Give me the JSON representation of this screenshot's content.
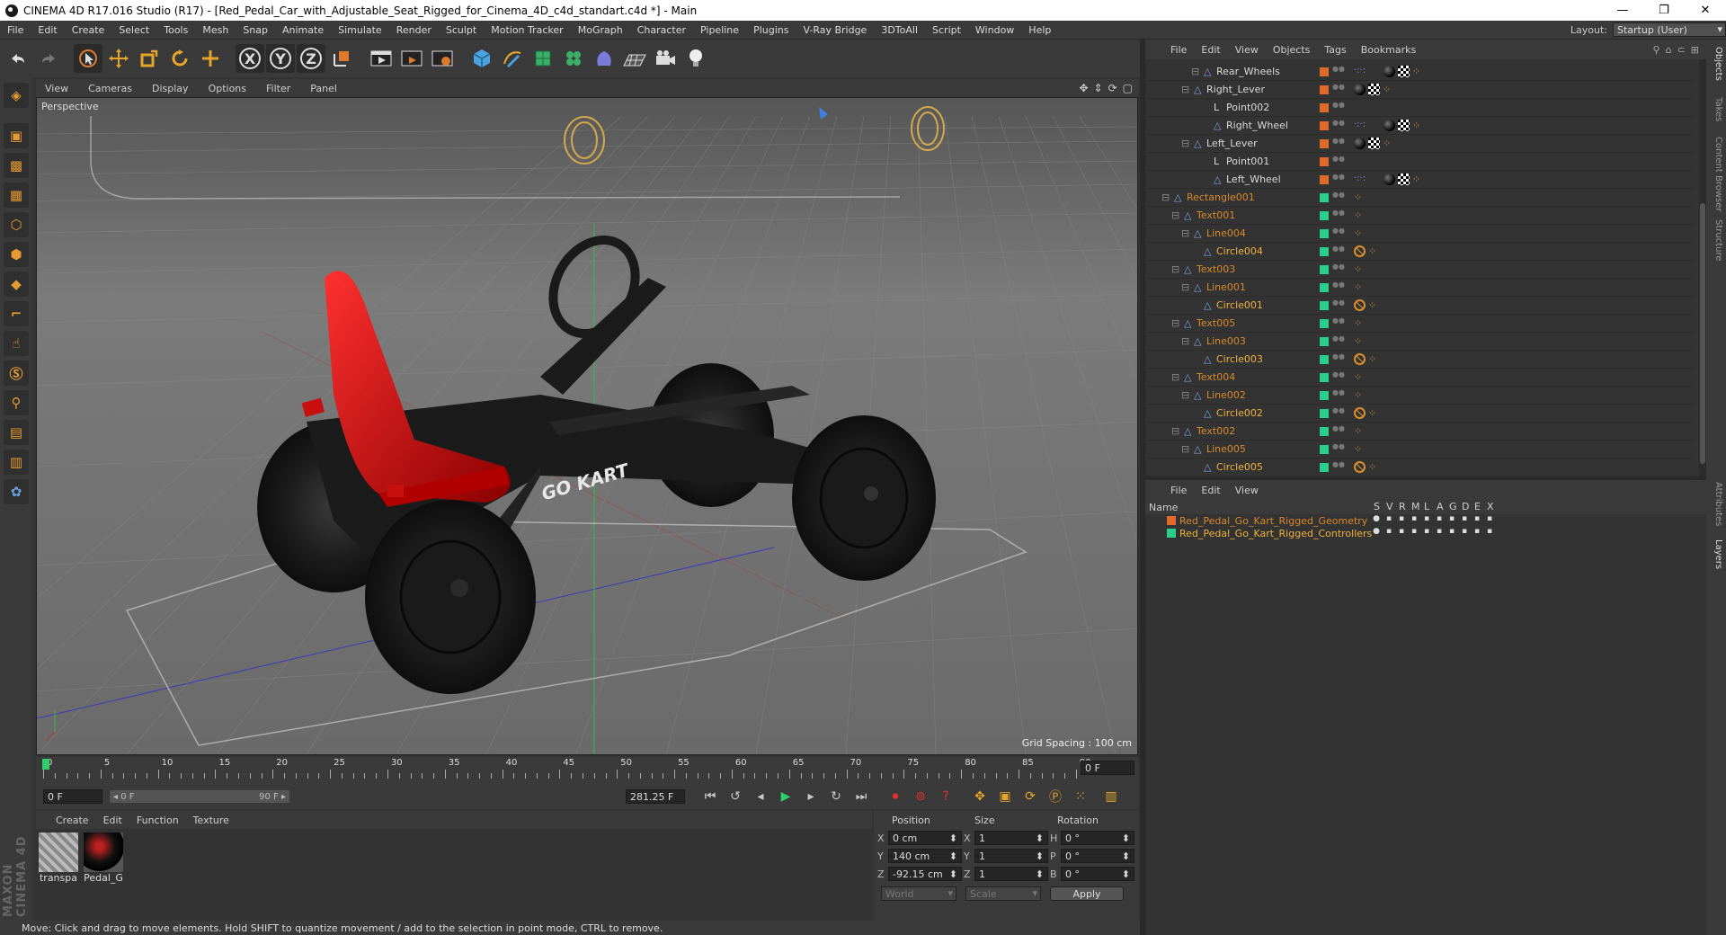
{
  "window": {
    "title": "CINEMA 4D R17.016 Studio (R17) - [Red_Pedal_Car_with_Adjustable_Seat_Rigged_for_Cinema_4D_c4d_standart.c4d *] - Main",
    "controls": [
      "—",
      "❐",
      "✕"
    ]
  },
  "menu": [
    "File",
    "Edit",
    "Create",
    "Select",
    "Tools",
    "Mesh",
    "Snap",
    "Animate",
    "Simulate",
    "Render",
    "Sculpt",
    "Motion Tracker",
    "MoGraph",
    "Character",
    "Pipeline",
    "Plugins",
    "V-Ray Bridge",
    "3DToAll",
    "Script",
    "Window",
    "Help"
  ],
  "layout": {
    "label": "Layout:",
    "value": "Startup (User)"
  },
  "toolbar": {
    "axis_x": "X",
    "axis_y": "Y",
    "axis_z": "Z",
    "icons": [
      "undo-icon",
      "redo-icon",
      "live-selection-icon",
      "move-icon",
      "scale-icon",
      "rotate-icon",
      "recent-tools-icon",
      "x-axis-icon",
      "y-axis-icon",
      "z-axis-icon",
      "coordinate-system-icon",
      "render-view-icon",
      "render-picture-viewer-icon",
      "edit-render-settings-icon",
      "cube-icon",
      "pen-spline-icon",
      "subdivision-icon",
      "cloner-icon",
      "deformer-icon",
      "floor-icon",
      "camera-icon",
      "light-icon"
    ]
  },
  "viewport": {
    "menu": [
      "View",
      "Cameras",
      "Display",
      "Options",
      "Filter",
      "Panel"
    ],
    "label": "Perspective",
    "grid_spacing": "Grid Spacing : 100 cm",
    "logo_text": "GO KART"
  },
  "timeline": {
    "ticks": [
      "0",
      "5",
      "10",
      "15",
      "20",
      "25",
      "30",
      "35",
      "40",
      "45",
      "50",
      "55",
      "60",
      "65",
      "70",
      "75",
      "80",
      "85",
      "90"
    ],
    "current_frame": "0 F"
  },
  "transport": {
    "start_frame": "0 F",
    "range_start": "◂ 0 F",
    "range_end": "90 F ▸",
    "end_frame": "281.25 F"
  },
  "materials": {
    "menu": [
      "Create",
      "Edit",
      "Function",
      "Texture"
    ],
    "items": [
      {
        "name": "transpa"
      },
      {
        "name": "Pedal_G"
      }
    ]
  },
  "coords": {
    "headers": [
      "Position",
      "Size",
      "Rotation"
    ],
    "rows": [
      {
        "axis": "X",
        "pos": "0 cm",
        "size_axis": "X",
        "size": "1",
        "rot_axis": "H",
        "rot": "0 °"
      },
      {
        "axis": "Y",
        "pos": "140 cm",
        "size_axis": "Y",
        "size": "1",
        "rot_axis": "P",
        "rot": "0 °"
      },
      {
        "axis": "Z",
        "pos": "-92.15 cm",
        "size_axis": "Z",
        "size": "1",
        "rot_axis": "B",
        "rot": "0 °"
      }
    ],
    "mode": "World",
    "size_mode": "Scale",
    "apply": "Apply"
  },
  "status": "Move: Click and drag to move elements. Hold SHIFT to quantize movement / add to the selection in point mode, CTRL to remove.",
  "object_manager": {
    "menu": [
      "File",
      "Edit",
      "View",
      "Objects",
      "Tags",
      "Bookmarks"
    ],
    "rows": [
      {
        "name": "Rear_Wheels",
        "indent": 5,
        "color": "#d9d9d9",
        "vis": "#e06a2a",
        "tags": "xpr"
      },
      {
        "name": "Right_Lever",
        "indent": 4,
        "color": "#d9d9d9",
        "vis": "#e06a2a",
        "tags": "sc"
      },
      {
        "name": "Point002",
        "indent": 6,
        "color": "#d9d9d9",
        "vis": "#e06a2a",
        "tags": ""
      },
      {
        "name": "Right_Wheel",
        "indent": 6,
        "color": "#d9d9d9",
        "vis": "#e06a2a",
        "tags": "xpr"
      },
      {
        "name": "Left_Lever",
        "indent": 4,
        "color": "#d9d9d9",
        "vis": "#e06a2a",
        "tags": "sc"
      },
      {
        "name": "Point001",
        "indent": 6,
        "color": "#d9d9d9",
        "vis": "#e06a2a",
        "tags": ""
      },
      {
        "name": "Left_Wheel",
        "indent": 6,
        "color": "#d9d9d9",
        "vis": "#e06a2a",
        "tags": "xpr"
      },
      {
        "name": "Rectangle001",
        "indent": 2,
        "color": "#d98a2a",
        "vis": "#2ad08a",
        "tags": "r"
      },
      {
        "name": "Text001",
        "indent": 3,
        "color": "#d98a2a",
        "vis": "#2ad08a",
        "tags": "r"
      },
      {
        "name": "Line004",
        "indent": 4,
        "color": "#d98a2a",
        "vis": "#2ad08a",
        "tags": "r"
      },
      {
        "name": "Circle004",
        "indent": 5,
        "color": "#f0b13a",
        "vis": "#2ad08a",
        "tags": "nr"
      },
      {
        "name": "Text003",
        "indent": 3,
        "color": "#d98a2a",
        "vis": "#2ad08a",
        "tags": "r"
      },
      {
        "name": "Line001",
        "indent": 4,
        "color": "#d98a2a",
        "vis": "#2ad08a",
        "tags": "r"
      },
      {
        "name": "Circle001",
        "indent": 5,
        "color": "#f0b13a",
        "vis": "#2ad08a",
        "tags": "nr"
      },
      {
        "name": "Text005",
        "indent": 3,
        "color": "#d98a2a",
        "vis": "#2ad08a",
        "tags": "r"
      },
      {
        "name": "Line003",
        "indent": 4,
        "color": "#d98a2a",
        "vis": "#2ad08a",
        "tags": "r"
      },
      {
        "name": "Circle003",
        "indent": 5,
        "color": "#f0b13a",
        "vis": "#2ad08a",
        "tags": "nr"
      },
      {
        "name": "Text004",
        "indent": 3,
        "color": "#d98a2a",
        "vis": "#2ad08a",
        "tags": "r"
      },
      {
        "name": "Line002",
        "indent": 4,
        "color": "#d98a2a",
        "vis": "#2ad08a",
        "tags": "r"
      },
      {
        "name": "Circle002",
        "indent": 5,
        "color": "#f0b13a",
        "vis": "#2ad08a",
        "tags": "nr"
      },
      {
        "name": "Text002",
        "indent": 3,
        "color": "#d98a2a",
        "vis": "#2ad08a",
        "tags": "r"
      },
      {
        "name": "Line005",
        "indent": 4,
        "color": "#d98a2a",
        "vis": "#2ad08a",
        "tags": "r"
      },
      {
        "name": "Circle005",
        "indent": 5,
        "color": "#f0b13a",
        "vis": "#2ad08a",
        "tags": "nr"
      }
    ]
  },
  "layer_manager": {
    "menu": [
      "File",
      "Edit",
      "View"
    ],
    "columns": [
      "Name",
      "S",
      "V",
      "R",
      "M",
      "L",
      "A",
      "G",
      "D",
      "E",
      "X"
    ],
    "rows": [
      {
        "name": "Red_Pedal_Go_Kart_Rigged_Geometry",
        "color": "#e06a2a",
        "text_color": "#d98a2a"
      },
      {
        "name": "Red_Pedal_Go_Kart_Rigged_Controllers",
        "color": "#2ad08a",
        "text_color": "#f0b13a"
      }
    ]
  },
  "side_tabs": [
    "Objects",
    "Takes",
    "Content Browser",
    "Structure",
    "Attributes",
    "Layers"
  ]
}
